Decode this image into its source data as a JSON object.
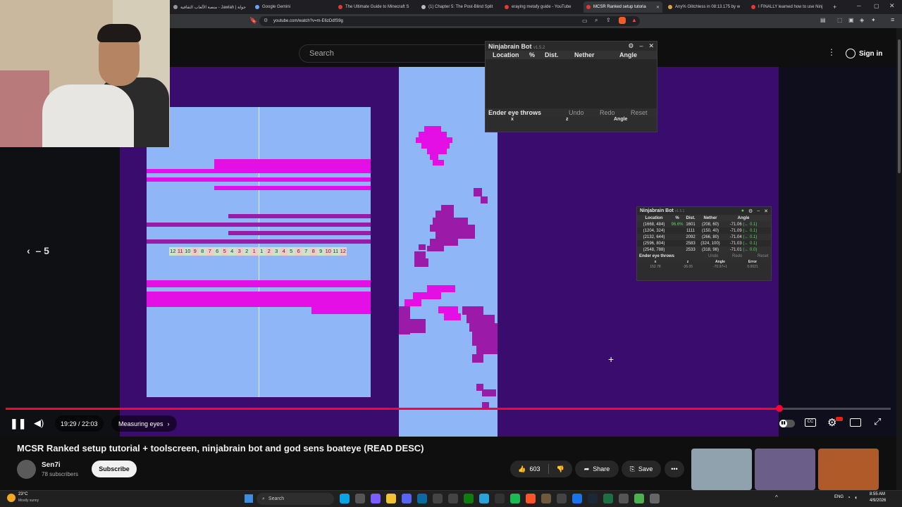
{
  "browser": {
    "tabs": [
      {
        "label": "منصة الألعاب الثقافية - Jawlah | جولة",
        "active": false
      },
      {
        "label": "Google Gemini",
        "active": false
      },
      {
        "label": "The Ultimate Guide to Minecraft S",
        "active": false
      },
      {
        "label": "(1) Chapter 5: The Post-Blind Split",
        "active": false
      },
      {
        "label": "eraying metafy guide - YouTube",
        "active": false
      },
      {
        "label": "MCSR Ranked setup tutoria",
        "active": true
      },
      {
        "label": "Any% Glitchless in 08:13.175 by w",
        "active": false
      },
      {
        "label": "I FINALLY learned how to use Ninj",
        "active": false
      }
    ],
    "url": "youtube.com/watch?v=m-E6zDdfS9g",
    "new_tab": "+"
  },
  "youtube": {
    "search_placeholder": "Search",
    "sign_in": "Sign in",
    "video_title": "MCSR Ranked setup tutorial + toolscreen, ninjabrain bot and god sens boateye (READ DESC)",
    "channel": "Sen7i",
    "subscribers": "78 subscribers",
    "subscribe": "Subscribe",
    "likes": "603",
    "share": "Share",
    "save": "Save",
    "time": "19:29 / 22:03",
    "chapter": "Measuring eyes",
    "seek_back": "‹  – 5",
    "progress": 0.874
  },
  "ninjabrain_large": {
    "title": "Ninjabrain Bot",
    "version": "v1.5.2",
    "columns": [
      "Location",
      "%",
      "Dist.",
      "Nether",
      "Angle"
    ],
    "throws_label": "Ender eye throws",
    "undo": "Undo",
    "redo": "Redo",
    "reset": "Reset",
    "sub_cols": [
      "x",
      "z",
      "Angle"
    ]
  },
  "ninjabrain_small": {
    "title": "Ninjabrain Bot",
    "version": "v1.5.1",
    "columns": [
      "Location",
      "%",
      "Dist.",
      "Nether",
      "Angle"
    ],
    "rows": [
      {
        "loc": "(1668, 484)",
        "pct": "96.6%",
        "dist": "1601",
        "nether": "(208, 60)",
        "angle": "-71.06",
        "delta": "(← 0.1)"
      },
      {
        "loc": "(1204, 324)",
        "pct": "",
        "dist": "1111",
        "nether": "(150, 40)",
        "angle": "-71.09",
        "delta": "(← 0.1)"
      },
      {
        "loc": "(2132, 644)",
        "pct": "",
        "dist": "2092",
        "nether": "(266, 80)",
        "angle": "-71.04",
        "delta": "(← 0.1)"
      },
      {
        "loc": "(2596, 804)",
        "pct": "",
        "dist": "2583",
        "nether": "(324, 100)",
        "angle": "-71.03",
        "delta": "(← 0.1)"
      },
      {
        "loc": "(2548, 788)",
        "pct": "",
        "dist": "2533",
        "nether": "(318, 98)",
        "angle": "-71.01",
        "delta": "(← 0.0)"
      }
    ],
    "throws_label": "Ender eye throws",
    "undo": "Undo",
    "redo": "Redo",
    "reset": "Reset",
    "throw_cols": [
      "x",
      "z",
      "Angle",
      "Error"
    ],
    "throw_vals": [
      "152.78",
      "-36.05",
      "-70.97+1",
      "0.0021"
    ]
  },
  "ruler": [
    "12",
    "11",
    "10",
    "9",
    "8",
    "7",
    "6",
    "5",
    "4",
    "3",
    "2",
    "1",
    "1",
    "2",
    "3",
    "4",
    "5",
    "6",
    "7",
    "8",
    "9",
    "10",
    "11",
    "12"
  ],
  "taskbar": {
    "weather_temp": "23°C",
    "weather_desc": "Mostly sunny",
    "search": "Search",
    "lang": "ENG",
    "time": "8:55 AM",
    "date": "4/9/2026"
  },
  "colors": {
    "video_bg": "#2a0a4a",
    "panel_bg": "#8fb6f7",
    "magenta": "#e40fe4",
    "progress_red": "#ff0033"
  }
}
